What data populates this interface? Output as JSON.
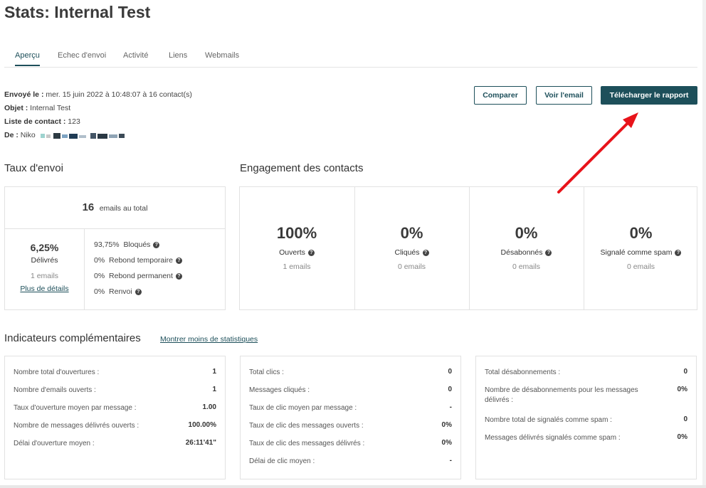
{
  "title": "Stats: Internal Test",
  "tabs": [
    {
      "label": "Aperçu"
    },
    {
      "label": "Echec d'envoi"
    },
    {
      "label": "Activité"
    },
    {
      "label": "Liens"
    },
    {
      "label": "Webmails"
    }
  ],
  "meta": {
    "sent_label": "Envoyé le :",
    "sent_value": "mer. 15 juin 2022 à 10:48:07 à 16 contact(s)",
    "subject_label": "Objet :",
    "subject_value": "Internal Test",
    "list_label": "Liste de contact :",
    "list_value": "123",
    "from_label": "De :",
    "from_value": "Niko"
  },
  "actions": {
    "compare": "Comparer",
    "view_email": "Voir l'email",
    "download": "Télécharger le rapport"
  },
  "delivery": {
    "title": "Taux d'envoi",
    "total_count": "16",
    "total_label": "emails au total",
    "delivered_pct": "6,25%",
    "delivered_label": "Délivrés",
    "delivered_count": "1 emails",
    "details_link": "Plus de détails",
    "rows": [
      {
        "pct": "93,75%",
        "label": "Bloqués"
      },
      {
        "pct": "0%",
        "label": "Rebond temporaire"
      },
      {
        "pct": "0%",
        "label": "Rebond permanent"
      },
      {
        "pct": "0%",
        "label": "Renvoi"
      }
    ]
  },
  "engagement": {
    "title": "Engagement des contacts",
    "cells": [
      {
        "pct": "100%",
        "label": "Ouverts",
        "count": "1 emails"
      },
      {
        "pct": "0%",
        "label": "Cliqués",
        "count": "0 emails"
      },
      {
        "pct": "0%",
        "label": "Désabonnés",
        "count": "0 emails"
      },
      {
        "pct": "0%",
        "label": "Signalé comme spam",
        "count": "0 emails"
      }
    ]
  },
  "indicators": {
    "title": "Indicateurs complémentaires",
    "toggle_link": "Montrer moins de statistiques",
    "col1": [
      {
        "label": "Nombre total d'ouvertures :",
        "value": "1"
      },
      {
        "label": "Nombre d'emails ouverts :",
        "value": "1"
      },
      {
        "label": "Taux d'ouverture moyen par message :",
        "value": "1.00"
      },
      {
        "label": "Nombre de messages délivrés ouverts :",
        "value": "100.00%"
      },
      {
        "label": "Délai d'ouverture moyen :",
        "value": "26:11'41\""
      }
    ],
    "col2": [
      {
        "label": "Total clics :",
        "value": "0"
      },
      {
        "label": "Messages cliqués :",
        "value": "0"
      },
      {
        "label": "Taux de clic moyen par message :",
        "value": "-"
      },
      {
        "label": "Taux de clic des messages ouverts :",
        "value": "0%"
      },
      {
        "label": "Taux de clic des messages délivrés :",
        "value": "0%"
      },
      {
        "label": "Délai de clic moyen :",
        "value": "-"
      }
    ],
    "col3": [
      {
        "label": "Total désabonnements :",
        "value": "0"
      },
      {
        "label": "Nombre de désabonnements pour les messages délivrés :",
        "value": "0%"
      },
      {
        "label": "Nombre total de signalés comme spam :",
        "value": "0"
      },
      {
        "label": "Messages délivrés signalés comme spam :",
        "value": "0%"
      }
    ]
  },
  "colors": {
    "accent": "#1d4f5a",
    "arrow": "#e8131a"
  },
  "icons": {
    "help": "question-circle-icon",
    "annotation": "red-arrow-annotation"
  }
}
